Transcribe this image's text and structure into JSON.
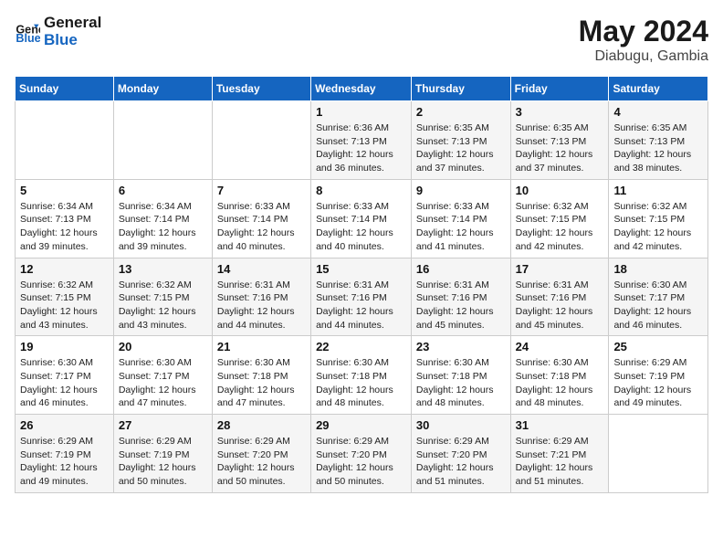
{
  "header": {
    "logo_line1": "General",
    "logo_line2": "Blue",
    "month_title": "May 2024",
    "location": "Diabugu, Gambia"
  },
  "days_of_week": [
    "Sunday",
    "Monday",
    "Tuesday",
    "Wednesday",
    "Thursday",
    "Friday",
    "Saturday"
  ],
  "weeks": [
    [
      {
        "day": "",
        "sunrise": "",
        "sunset": "",
        "daylight": ""
      },
      {
        "day": "",
        "sunrise": "",
        "sunset": "",
        "daylight": ""
      },
      {
        "day": "",
        "sunrise": "",
        "sunset": "",
        "daylight": ""
      },
      {
        "day": "1",
        "sunrise": "Sunrise: 6:36 AM",
        "sunset": "Sunset: 7:13 PM",
        "daylight": "Daylight: 12 hours and 36 minutes."
      },
      {
        "day": "2",
        "sunrise": "Sunrise: 6:35 AM",
        "sunset": "Sunset: 7:13 PM",
        "daylight": "Daylight: 12 hours and 37 minutes."
      },
      {
        "day": "3",
        "sunrise": "Sunrise: 6:35 AM",
        "sunset": "Sunset: 7:13 PM",
        "daylight": "Daylight: 12 hours and 37 minutes."
      },
      {
        "day": "4",
        "sunrise": "Sunrise: 6:35 AM",
        "sunset": "Sunset: 7:13 PM",
        "daylight": "Daylight: 12 hours and 38 minutes."
      }
    ],
    [
      {
        "day": "5",
        "sunrise": "Sunrise: 6:34 AM",
        "sunset": "Sunset: 7:13 PM",
        "daylight": "Daylight: 12 hours and 39 minutes."
      },
      {
        "day": "6",
        "sunrise": "Sunrise: 6:34 AM",
        "sunset": "Sunset: 7:14 PM",
        "daylight": "Daylight: 12 hours and 39 minutes."
      },
      {
        "day": "7",
        "sunrise": "Sunrise: 6:33 AM",
        "sunset": "Sunset: 7:14 PM",
        "daylight": "Daylight: 12 hours and 40 minutes."
      },
      {
        "day": "8",
        "sunrise": "Sunrise: 6:33 AM",
        "sunset": "Sunset: 7:14 PM",
        "daylight": "Daylight: 12 hours and 40 minutes."
      },
      {
        "day": "9",
        "sunrise": "Sunrise: 6:33 AM",
        "sunset": "Sunset: 7:14 PM",
        "daylight": "Daylight: 12 hours and 41 minutes."
      },
      {
        "day": "10",
        "sunrise": "Sunrise: 6:32 AM",
        "sunset": "Sunset: 7:15 PM",
        "daylight": "Daylight: 12 hours and 42 minutes."
      },
      {
        "day": "11",
        "sunrise": "Sunrise: 6:32 AM",
        "sunset": "Sunset: 7:15 PM",
        "daylight": "Daylight: 12 hours and 42 minutes."
      }
    ],
    [
      {
        "day": "12",
        "sunrise": "Sunrise: 6:32 AM",
        "sunset": "Sunset: 7:15 PM",
        "daylight": "Daylight: 12 hours and 43 minutes."
      },
      {
        "day": "13",
        "sunrise": "Sunrise: 6:32 AM",
        "sunset": "Sunset: 7:15 PM",
        "daylight": "Daylight: 12 hours and 43 minutes."
      },
      {
        "day": "14",
        "sunrise": "Sunrise: 6:31 AM",
        "sunset": "Sunset: 7:16 PM",
        "daylight": "Daylight: 12 hours and 44 minutes."
      },
      {
        "day": "15",
        "sunrise": "Sunrise: 6:31 AM",
        "sunset": "Sunset: 7:16 PM",
        "daylight": "Daylight: 12 hours and 44 minutes."
      },
      {
        "day": "16",
        "sunrise": "Sunrise: 6:31 AM",
        "sunset": "Sunset: 7:16 PM",
        "daylight": "Daylight: 12 hours and 45 minutes."
      },
      {
        "day": "17",
        "sunrise": "Sunrise: 6:31 AM",
        "sunset": "Sunset: 7:16 PM",
        "daylight": "Daylight: 12 hours and 45 minutes."
      },
      {
        "day": "18",
        "sunrise": "Sunrise: 6:30 AM",
        "sunset": "Sunset: 7:17 PM",
        "daylight": "Daylight: 12 hours and 46 minutes."
      }
    ],
    [
      {
        "day": "19",
        "sunrise": "Sunrise: 6:30 AM",
        "sunset": "Sunset: 7:17 PM",
        "daylight": "Daylight: 12 hours and 46 minutes."
      },
      {
        "day": "20",
        "sunrise": "Sunrise: 6:30 AM",
        "sunset": "Sunset: 7:17 PM",
        "daylight": "Daylight: 12 hours and 47 minutes."
      },
      {
        "day": "21",
        "sunrise": "Sunrise: 6:30 AM",
        "sunset": "Sunset: 7:18 PM",
        "daylight": "Daylight: 12 hours and 47 minutes."
      },
      {
        "day": "22",
        "sunrise": "Sunrise: 6:30 AM",
        "sunset": "Sunset: 7:18 PM",
        "daylight": "Daylight: 12 hours and 48 minutes."
      },
      {
        "day": "23",
        "sunrise": "Sunrise: 6:30 AM",
        "sunset": "Sunset: 7:18 PM",
        "daylight": "Daylight: 12 hours and 48 minutes."
      },
      {
        "day": "24",
        "sunrise": "Sunrise: 6:30 AM",
        "sunset": "Sunset: 7:18 PM",
        "daylight": "Daylight: 12 hours and 48 minutes."
      },
      {
        "day": "25",
        "sunrise": "Sunrise: 6:29 AM",
        "sunset": "Sunset: 7:19 PM",
        "daylight": "Daylight: 12 hours and 49 minutes."
      }
    ],
    [
      {
        "day": "26",
        "sunrise": "Sunrise: 6:29 AM",
        "sunset": "Sunset: 7:19 PM",
        "daylight": "Daylight: 12 hours and 49 minutes."
      },
      {
        "day": "27",
        "sunrise": "Sunrise: 6:29 AM",
        "sunset": "Sunset: 7:19 PM",
        "daylight": "Daylight: 12 hours and 50 minutes."
      },
      {
        "day": "28",
        "sunrise": "Sunrise: 6:29 AM",
        "sunset": "Sunset: 7:20 PM",
        "daylight": "Daylight: 12 hours and 50 minutes."
      },
      {
        "day": "29",
        "sunrise": "Sunrise: 6:29 AM",
        "sunset": "Sunset: 7:20 PM",
        "daylight": "Daylight: 12 hours and 50 minutes."
      },
      {
        "day": "30",
        "sunrise": "Sunrise: 6:29 AM",
        "sunset": "Sunset: 7:20 PM",
        "daylight": "Daylight: 12 hours and 51 minutes."
      },
      {
        "day": "31",
        "sunrise": "Sunrise: 6:29 AM",
        "sunset": "Sunset: 7:21 PM",
        "daylight": "Daylight: 12 hours and 51 minutes."
      },
      {
        "day": "",
        "sunrise": "",
        "sunset": "",
        "daylight": ""
      }
    ]
  ]
}
